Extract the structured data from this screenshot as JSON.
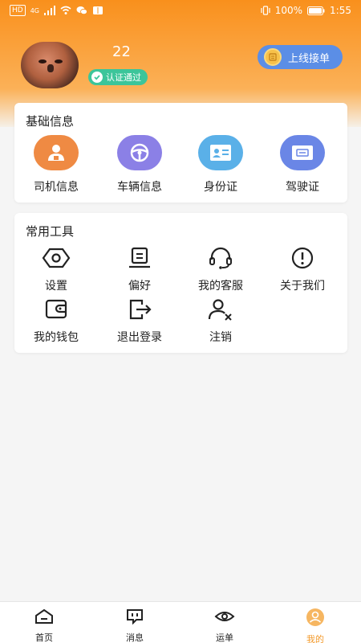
{
  "status": {
    "left_badge": "HD",
    "network": "4G",
    "battery": "100%",
    "time": "1:55"
  },
  "profile": {
    "user_id": "22",
    "verify_text": "认证通过",
    "online_button": "上线接单"
  },
  "basic_info": {
    "title": "基础信息",
    "items": [
      {
        "label": "司机信息",
        "icon": "driver-icon",
        "color": "#ef8a43"
      },
      {
        "label": "车辆信息",
        "icon": "steering-wheel-icon",
        "color": "#8b80e6"
      },
      {
        "label": "身份证",
        "icon": "id-card-icon",
        "color": "#5ab0e8"
      },
      {
        "label": "驾驶证",
        "icon": "license-icon",
        "color": "#6a86e6"
      }
    ]
  },
  "tools": {
    "title": "常用工具",
    "items": [
      {
        "label": "设置",
        "icon": "settings-icon"
      },
      {
        "label": "偏好",
        "icon": "preference-icon"
      },
      {
        "label": "我的客服",
        "icon": "headset-icon"
      },
      {
        "label": "关于我们",
        "icon": "info-icon"
      },
      {
        "label": "我的钱包",
        "icon": "wallet-icon"
      },
      {
        "label": "退出登录",
        "icon": "logout-icon"
      },
      {
        "label": "注销",
        "icon": "user-remove-icon"
      }
    ]
  },
  "tabbar": {
    "items": [
      {
        "label": "首页",
        "icon": "home-icon"
      },
      {
        "label": "消息",
        "icon": "message-icon"
      },
      {
        "label": "运单",
        "icon": "eye-icon"
      },
      {
        "label": "我的",
        "icon": "user-icon",
        "active": true
      }
    ]
  },
  "colors": {
    "brand_orange": "#f9901c",
    "verify_green": "#3cc59a",
    "online_blue": "#5b8ee6",
    "tab_active": "#f39a2c"
  }
}
